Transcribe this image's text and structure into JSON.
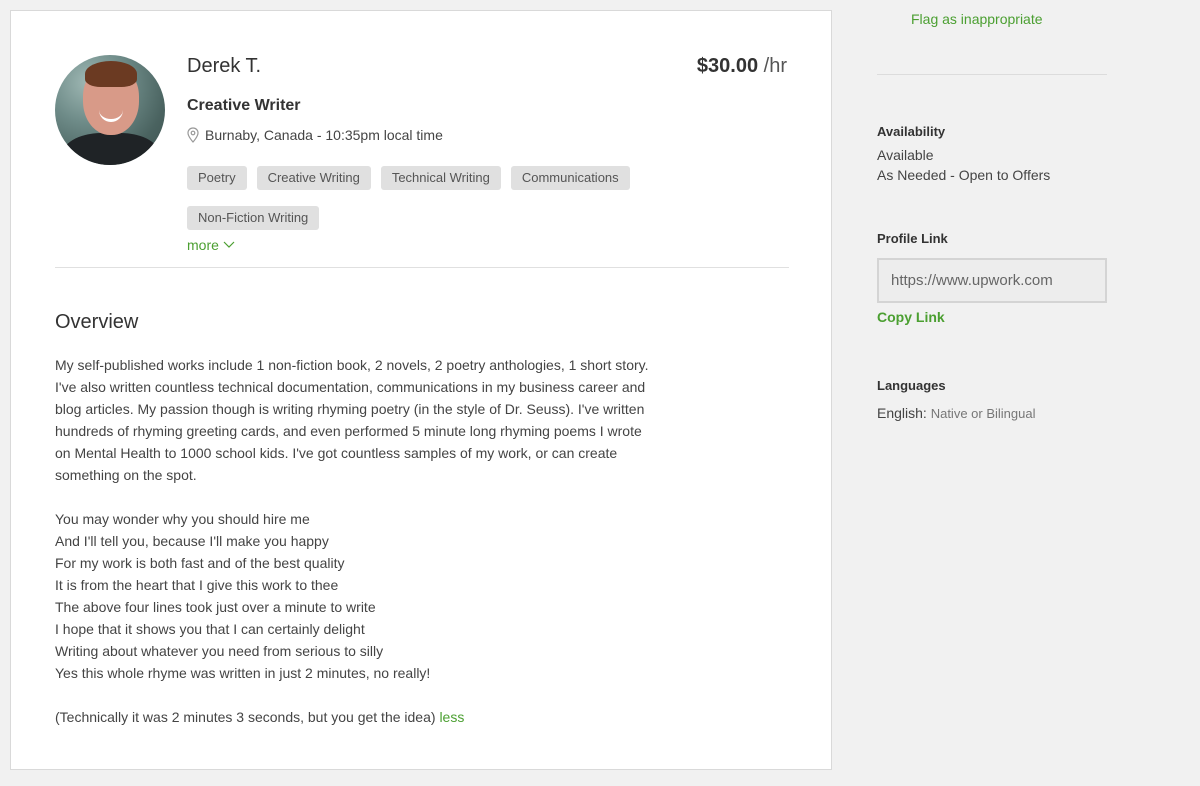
{
  "profile": {
    "name": "Derek T.",
    "rate_value": "$30.00",
    "rate_unit": "/hr",
    "title": "Creative Writer",
    "location": "Burnaby, Canada - 10:35pm local time",
    "skills": [
      "Poetry",
      "Creative Writing",
      "Technical Writing",
      "Communications",
      "Non-Fiction Writing"
    ],
    "more_label": "more"
  },
  "overview": {
    "heading": "Overview",
    "paragraph1": [
      "My self-published works include 1 non-fiction book, 2 novels, 2 poetry anthologies, 1 short story.",
      "I've also written countless technical documentation, communications in my business career and",
      "blog articles. My passion though is writing rhyming poetry (in the style of Dr. Seuss). I've written",
      "hundreds of rhyming greeting cards, and even performed 5 minute long rhyming poems I wrote",
      "on Mental Health to 1000 school kids. I've got countless samples of my work, or can create",
      "something on the spot."
    ],
    "poem": [
      "You may wonder why you should hire me",
      "And I'll tell you, because I'll make you happy",
      "For my work is both fast and of the best quality",
      "It is from the heart that I give this work to thee",
      "The above four lines took just over a minute to write",
      "I hope that it shows you that I can certainly delight",
      "Writing about whatever you need from serious to silly",
      "Yes this whole rhyme was written in just 2 minutes, no really!"
    ],
    "closing": "(Technically it was 2 minutes 3 seconds, but you get the idea)",
    "less_label": "less"
  },
  "sidebar": {
    "flag_label": "Flag as inappropriate",
    "availability_label": "Availability",
    "availability_status": "Available",
    "availability_detail": "As Needed - Open to Offers",
    "profile_link_label": "Profile Link",
    "profile_link_value": "https://www.upwork.com",
    "copy_link_label": "Copy Link",
    "languages_label": "Languages",
    "language_name": "English:",
    "language_level": "Native or Bilingual"
  },
  "colors": {
    "accent_green": "#4b9f31",
    "skill_bg": "#e0e0e0"
  }
}
